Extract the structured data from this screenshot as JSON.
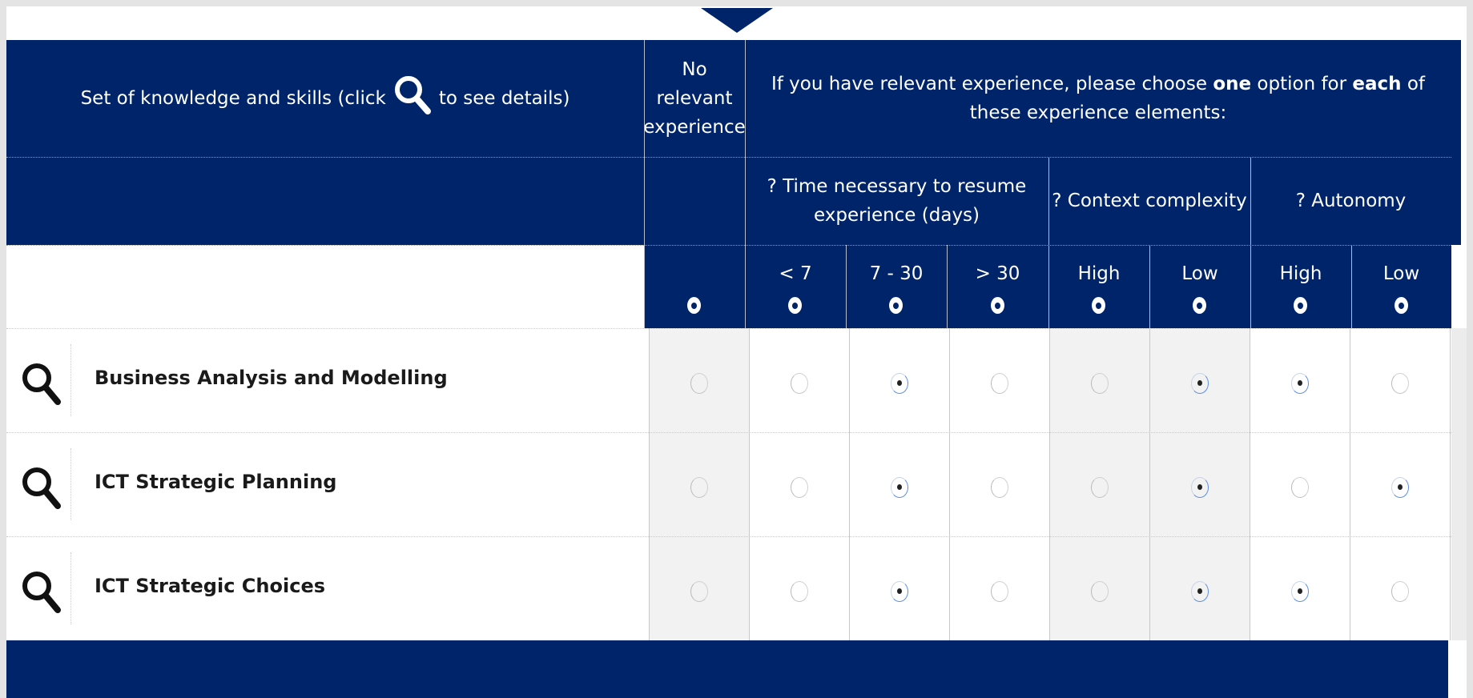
{
  "header": {
    "set_label_pre": "Set of knowledge and skills (click",
    "set_label_post": "to see details)",
    "no_relevant_lines": [
      "No",
      "relevant",
      "experience"
    ],
    "instruction_parts": [
      "If you have relevant experience, please choose ",
      "one",
      " option for ",
      "each",
      " of these experience elements:"
    ],
    "groups": [
      {
        "label": "? Time necessary to resume experience (days)"
      },
      {
        "label": "? Context complexity"
      },
      {
        "label": "? Autonomy"
      }
    ],
    "options": [
      "< 7",
      "7 - 30",
      "> 30",
      "High",
      "Low",
      "High",
      "Low"
    ]
  },
  "icons": {
    "details": "magnifier-icon"
  },
  "colors": {
    "header_bg": "#002469",
    "highlight_column": "#f2f2f2"
  },
  "rows": [
    {
      "name": "Business Analysis and Modelling",
      "no_relevant": false,
      "time": "7 - 30",
      "complexity": "Low",
      "autonomy": "High"
    },
    {
      "name": "ICT Strategic Planning",
      "no_relevant": false,
      "time": "7 - 30",
      "complexity": "Low",
      "autonomy": "Low"
    },
    {
      "name": "ICT Strategic Choices",
      "no_relevant": false,
      "time": "7 - 30",
      "complexity": "Low",
      "autonomy": "High"
    }
  ]
}
